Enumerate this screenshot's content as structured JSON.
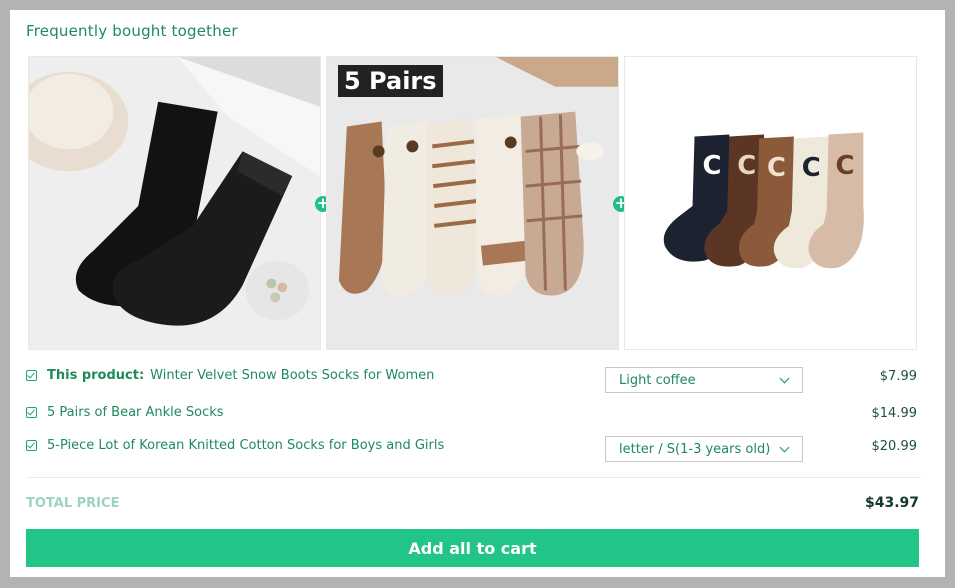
{
  "section": {
    "title": "Frequently bought together"
  },
  "images": [
    {
      "icon": "black-velvet-socks-photo"
    },
    {
      "icon": "bear-ankle-socks-photo",
      "badge": "5 Pairs"
    },
    {
      "icon": "korean-knitted-socks-photo"
    }
  ],
  "plus_symbol": "+",
  "products": [
    {
      "checked": true,
      "prefix": "This product:",
      "name": "Winter Velvet Snow Boots Socks for Women",
      "option": "Light coffee",
      "price": "$7.99"
    },
    {
      "checked": true,
      "prefix": "",
      "name": "5 Pairs of Bear Ankle Socks",
      "option": "",
      "price": "$14.99"
    },
    {
      "checked": true,
      "prefix": "",
      "name": "5-Piece Lot of Korean Knitted Cotton Socks for Boys and Girls",
      "option": "letter / S(1-3 years old)",
      "price": "$20.99"
    }
  ],
  "total": {
    "label": "TOTAL PRICE",
    "value": "$43.97"
  },
  "cart_button": {
    "label": "Add all to cart"
  },
  "colors": {
    "accent": "#23c487",
    "text_green": "#1f8a5c"
  }
}
